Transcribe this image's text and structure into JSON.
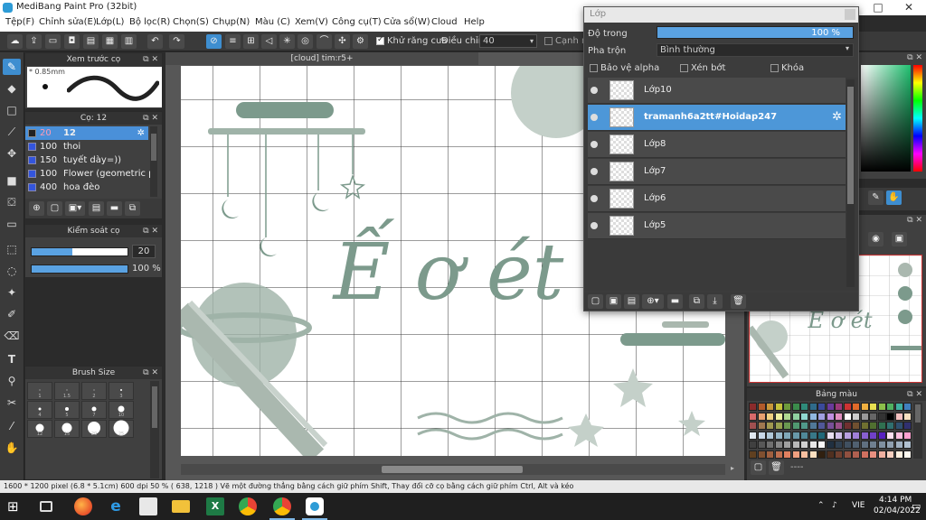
{
  "window": {
    "title": "MediBang Paint Pro (32bit)",
    "controls": [
      "─",
      "□",
      "✕"
    ]
  },
  "menu": [
    "Tệp(F)",
    "Chỉnh sửa(E)",
    "Lớp(L)",
    "Bộ lọc(R)",
    "Chọn(S)",
    "Chụp(N)",
    "Màu (C)",
    "Xem(V)",
    "Công cụ(T)",
    "Cửa sổ(W)",
    "Cloud",
    "Help"
  ],
  "toolbar": {
    "antialias_label": "Khử răng cưa",
    "adjust_label": "Điều chỉnh",
    "adjust_value": "40",
    "edge_label": "Cạnh m"
  },
  "brush_preview": {
    "title": "Xem trước cọ",
    "size_label": "* 0.85mm"
  },
  "brush_panel": {
    "title": "Cọ: 12",
    "rows": [
      {
        "size": "20",
        "name": "12",
        "selected": true
      },
      {
        "size": "100",
        "name": "thoi"
      },
      {
        "size": "150",
        "name": "tuyết dày=))"
      },
      {
        "size": "100",
        "name": "Flower (geometric patt"
      },
      {
        "size": "400",
        "name": "hoa đèo"
      }
    ]
  },
  "brush_control": {
    "title": "Kiểm soát cọ",
    "size_value": "20",
    "opacity_label": "100 %",
    "size_fraction": 0.42,
    "opacity_fraction": 1.0
  },
  "brush_size_panel": {
    "title": "Brush Size",
    "cells": [
      {
        "label": "1",
        "d": 1
      },
      {
        "label": "1.5",
        "d": 1
      },
      {
        "label": "2",
        "d": 1
      },
      {
        "label": "3",
        "d": 2
      },
      {
        "label": "4",
        "d": 3
      },
      {
        "label": "5",
        "d": 4
      },
      {
        "label": "7",
        "d": 5
      },
      {
        "label": "10",
        "d": 7
      },
      {
        "label": "12",
        "d": 9
      },
      {
        "label": "15",
        "d": 11
      },
      {
        "label": "20",
        "d": 14
      },
      {
        "label": "25",
        "d": 17
      }
    ]
  },
  "document": {
    "tab_title": "[cloud] tim:r5+",
    "text_strokes": "Ế ơ ét"
  },
  "layer_window": {
    "title": "Lớp",
    "opacity_label": "Độ trong",
    "opacity_value": "100 %",
    "opacity_fraction": 1.0,
    "blend_label": "Pha trộn",
    "blend_value": "Bình thường",
    "protect_alpha": "Bảo vệ alpha",
    "clipping": "Xén bớt",
    "lock": "Khóa",
    "layers": [
      {
        "name": "Lớp10",
        "selected": false
      },
      {
        "name": "tramanh6a2tt#Hoidap247",
        "selected": true
      },
      {
        "name": "Lớp8",
        "selected": false
      },
      {
        "name": "Lớp7",
        "selected": false
      },
      {
        "name": "Lớp6",
        "selected": false
      },
      {
        "name": "Lớp5",
        "selected": false
      }
    ]
  },
  "navigator_text": "Ế ơ ét",
  "palette": {
    "title": "Bảng màu",
    "more": "----",
    "colors": [
      "#8b2b2b",
      "#b35a2a",
      "#c9973a",
      "#c7c23b",
      "#6e9b3b",
      "#3b8b4b",
      "#2f8b7a",
      "#2f6b8b",
      "#3a4a9b",
      "#6a3a9b",
      "#9b3a7a",
      "#cc3333",
      "#e06a2a",
      "#f0b040",
      "#e8e050",
      "#8cc04a",
      "#50b060",
      "#40b0a0",
      "#4080c0",
      "#d86a6a",
      "#e8a070",
      "#f0d080",
      "#f0f0a0",
      "#b0d890",
      "#90d0a0",
      "#90d8d0",
      "#90b8e0",
      "#a0a0e0",
      "#c090e0",
      "#e090c0",
      "#ffffff",
      "#cccccc",
      "#999999",
      "#666666",
      "#333333",
      "#000000",
      "#f4c0c0",
      "#f8e0c0",
      "#a05050",
      "#a07850",
      "#a09850",
      "#98a050",
      "#6a9850",
      "#509870",
      "#50988a",
      "#507898",
      "#505898",
      "#785098",
      "#985088",
      "#703030",
      "#705030",
      "#707030",
      "#507030",
      "#307050",
      "#307070",
      "#305070",
      "#303070",
      "#e0e8f0",
      "#c8d8e8",
      "#b0c8d8",
      "#98b8c8",
      "#80a8b8",
      "#6898a8",
      "#508898",
      "#387888",
      "#206878",
      "#e8e0f0",
      "#d0c0e8",
      "#b8a0e0",
      "#a080d8",
      "#8860d0",
      "#7040c8",
      "#5820c0",
      "#ffe0f0",
      "#ffc0e0",
      "#ffa0d0",
      "#404040",
      "#585858",
      "#707070",
      "#888888",
      "#a0a0a0",
      "#b8b8b8",
      "#d0d0d0",
      "#e8e8e8",
      "#f8f8f8",
      "#203040",
      "#304050",
      "#405060",
      "#506070",
      "#607080",
      "#708090",
      "#8090a0",
      "#90a0b0",
      "#a0b0c0",
      "#b0c0d0",
      "#604020",
      "#805030",
      "#a06040",
      "#c07050",
      "#e08060",
      "#f0a080",
      "#f8c0a0",
      "#fce0c0",
      "#302010",
      "#503020",
      "#704030",
      "#905040",
      "#b06050",
      "#d07060",
      "#e89080",
      "#f0b0a0",
      "#f8d0c0",
      "#fff0e0",
      "#fffaf0"
    ]
  },
  "status": "1600 * 1200 pixel   (6.8 * 5.1cm)   600 dpi   50 %   ( 638, 1218 )   Vẽ một đường thẳng bằng cách giữ phím Shift, Thay đổi cỡ cọ bằng cách giữ phím Ctrl, Alt và kéo",
  "taskbar": {
    "lang": "VIE",
    "time": "4:14 PM",
    "date": "02/04/2022"
  }
}
